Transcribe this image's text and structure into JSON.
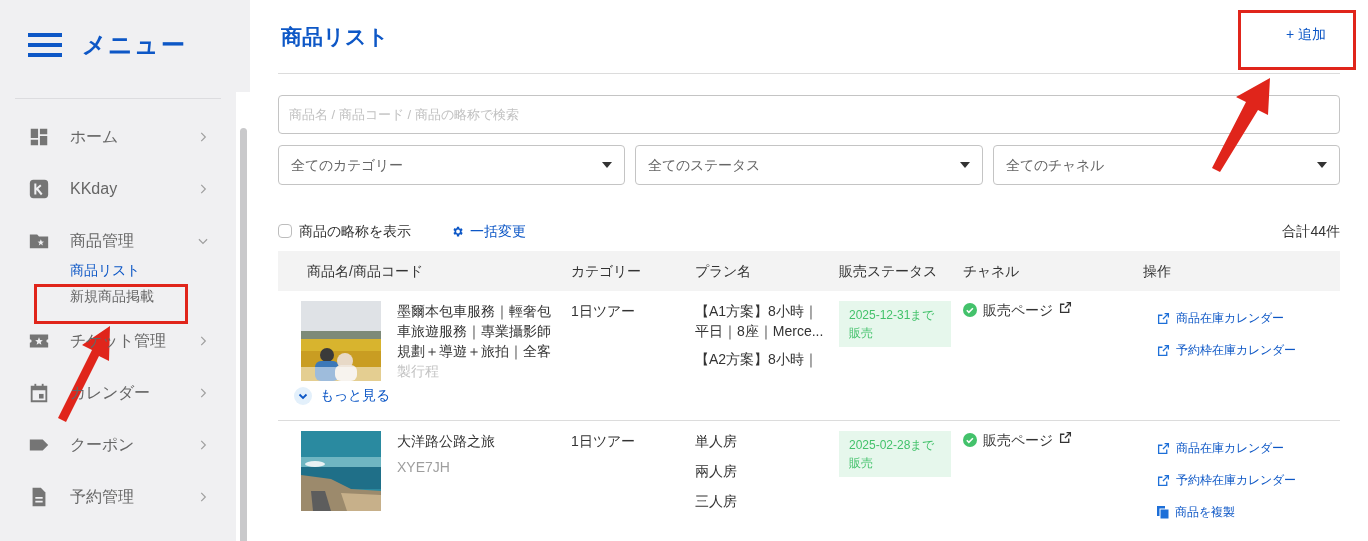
{
  "sidebar": {
    "title": "メニュー",
    "items": [
      {
        "label": "ホーム",
        "expanded": false
      },
      {
        "label": "KKday",
        "expanded": false
      },
      {
        "label": "商品管理",
        "expanded": true,
        "children": [
          {
            "label": "商品リスト",
            "selected": true
          },
          {
            "label": "新規商品掲載",
            "selected": false
          }
        ]
      },
      {
        "label": "チケット管理",
        "expanded": false
      },
      {
        "label": "カレンダー",
        "expanded": false
      },
      {
        "label": "クーポン",
        "expanded": false
      },
      {
        "label": "予約管理",
        "expanded": false
      }
    ]
  },
  "page": {
    "title": "商品リスト",
    "add_button": "+ 追加"
  },
  "search": {
    "placeholder": "商品名 / 商品コード / 商品の略称で検索"
  },
  "filters": [
    "全てのカテゴリー",
    "全てのステータス",
    "全てのチャネル"
  ],
  "toolbar": {
    "abbr_checkbox": {
      "label": "商品の略称を表示",
      "checked": false
    },
    "bulk_edit": "一括変更",
    "total": "合計44件"
  },
  "table": {
    "columns": [
      "商品名/商品コード",
      "カテゴリー",
      "プラン名",
      "販売ステータス",
      "チャネル",
      "操作"
    ],
    "rows": [
      {
        "name_lines": [
          "墨爾本包車服務｜輕奢包",
          "車旅遊服務｜專業攝影師",
          "規劃＋導遊＋旅拍｜全客"
        ],
        "name_faded": "製行程",
        "code": "",
        "more": "もっと見る",
        "category": "1日ツアー",
        "plans": [
          "【A1方案】8小時｜平日｜8座｜Merce...",
          "【A2方案】8小時｜"
        ],
        "status": "2025-12-31まで販売",
        "channel": "販売ページ",
        "actions": [
          {
            "label": "商品在庫カレンダー",
            "kind": "link"
          },
          {
            "label": "予約枠在庫カレンダー",
            "kind": "link"
          }
        ]
      },
      {
        "name_lines": [
          "大洋路公路之旅"
        ],
        "code": "XYE7JH",
        "category": "1日ツアー",
        "plans": [
          "単人房",
          "兩人房",
          "三人房"
        ],
        "status": "2025-02-28まで販売",
        "channel": "販売ページ",
        "actions": [
          {
            "label": "商品在庫カレンダー",
            "kind": "link"
          },
          {
            "label": "予約枠在庫カレンダー",
            "kind": "link"
          },
          {
            "label": "商品を複製",
            "kind": "copy"
          }
        ]
      }
    ]
  }
}
